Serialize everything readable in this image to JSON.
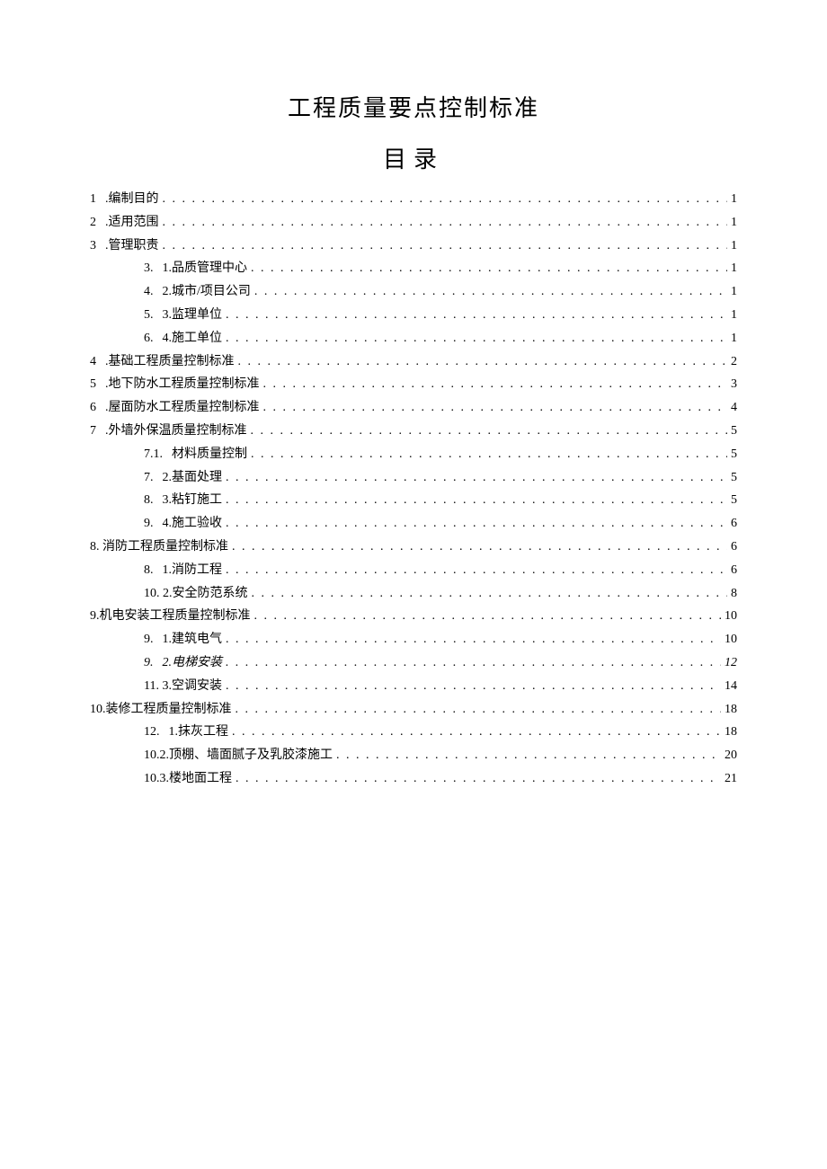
{
  "title": "工程质量要点控制标准",
  "subtitle": "目录",
  "entries": [
    {
      "level": 0,
      "num": "1",
      "label": ".编制目的",
      "page": "1",
      "split": true
    },
    {
      "level": 0,
      "num": "2",
      "label": ".适用范围",
      "page": "1",
      "split": true
    },
    {
      "level": 0,
      "num": "3",
      "label": ".管理职责",
      "page": "1",
      "split": true
    },
    {
      "level": 1,
      "num": "3.",
      "label": "1.品质管理中心",
      "page": "1",
      "split": true
    },
    {
      "level": 1,
      "num": "4.",
      "label": "2.城市/项目公司",
      "page": "1",
      "split": true
    },
    {
      "level": 1,
      "num": "5.",
      "label": "3.监理单位",
      "page": "1",
      "split": true
    },
    {
      "level": 1,
      "num": "6.",
      "label": "4.施工单位",
      "page": "1",
      "split": true
    },
    {
      "level": 0,
      "num": "4",
      "label": ".基础工程质量控制标准",
      "page": "2",
      "split": true
    },
    {
      "level": 0,
      "num": "5",
      "label": ".地下防水工程质量控制标准",
      "page": "3",
      "split": true
    },
    {
      "level": 0,
      "num": "6",
      "label": ".屋面防水工程质量控制标准",
      "page": "4",
      "split": true
    },
    {
      "level": 0,
      "num": "7",
      "label": ".外墙外保温质量控制标准",
      "page": "5",
      "split": true
    },
    {
      "level": 1,
      "num": "7.1.",
      "label": "材料质量控制",
      "page": "5",
      "split": true
    },
    {
      "level": 1,
      "num": "7.",
      "label": "2.基面处理",
      "page": "5",
      "split": true
    },
    {
      "level": 1,
      "num": "8.",
      "label": "3.粘钉施工",
      "page": "5",
      "split": true
    },
    {
      "level": 1,
      "num": "9.",
      "label": "4.施工验收",
      "page": "6",
      "split": true
    },
    {
      "level": 0,
      "num": "",
      "label": "8. 消防工程质量控制标准",
      "page": "6",
      "split": false
    },
    {
      "level": 1,
      "num": "8.",
      "label": "1.消防工程",
      "page": "6",
      "split": true
    },
    {
      "level": 1,
      "num": "",
      "label": "10. 2.安全防范系统",
      "page": "8",
      "split": false
    },
    {
      "level": 0,
      "num": "",
      "label": "9.机电安装工程质量控制标准",
      "page": "10",
      "split": false
    },
    {
      "level": 1,
      "num": "9.",
      "label": "1.建筑电气",
      "page": "10",
      "split": true
    },
    {
      "level": 1,
      "num": "9.",
      "label": "2.电梯安装",
      "page": "12",
      "split": true,
      "italic": true
    },
    {
      "level": 1,
      "num": "",
      "label": "11. 3.空调安装",
      "page": "14",
      "split": false
    },
    {
      "level": 0,
      "num": "",
      "label": "10.装修工程质量控制标准",
      "page": "18",
      "split": false
    },
    {
      "level": 1,
      "num": "12.",
      "label": "1.抹灰工程",
      "page": "18",
      "split": true
    },
    {
      "level": 1,
      "num": "",
      "label": "10.2.顶棚、墙面腻子及乳胶漆施工",
      "page": "20",
      "split": false
    },
    {
      "level": 1,
      "num": "",
      "label": "10.3.楼地面工程",
      "page": "21",
      "split": false
    }
  ]
}
